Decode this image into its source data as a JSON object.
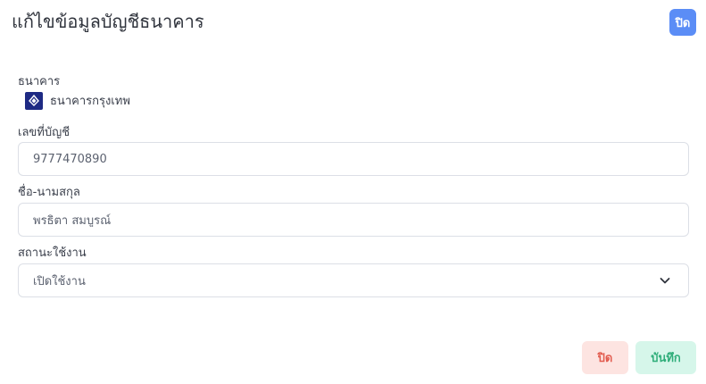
{
  "modal": {
    "title": "แก้ไขข้อมูลบัญชีธนาคาร",
    "close_label": "ปิด"
  },
  "bank": {
    "label": "ธนาคาร",
    "name": "ธนาคารกรุงเทพ",
    "logo_icon": "bangkok-bank-logo-icon",
    "logo_color": "#1e2a84"
  },
  "account_number": {
    "label": "เลขที่บัญชี",
    "value": "9777470890"
  },
  "full_name": {
    "label": "ชื่อ-นามสกุล",
    "value": "พรธิตา สมบูรณ์"
  },
  "status": {
    "label": "สถานะใช้งาน",
    "selected": "เปิดใช้งาน",
    "icon": "chevron-down-icon"
  },
  "footer": {
    "cancel_label": "ปิด",
    "save_label": "บันทึก",
    "cancel_color": "#e25c4f",
    "save_color": "#2fae7a"
  },
  "colors": {
    "primary": "#5b8df6",
    "border": "#dcdfe6"
  }
}
